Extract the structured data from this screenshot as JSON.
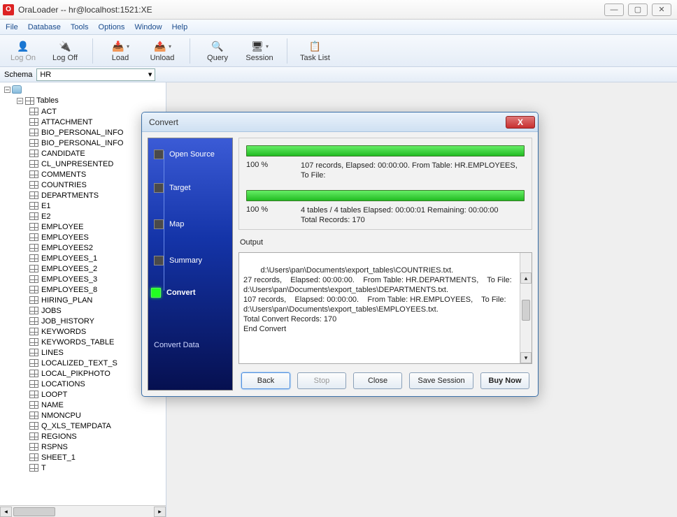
{
  "window": {
    "title": "OraLoader -- hr@localhost:1521:XE"
  },
  "menu": {
    "file": "File",
    "database": "Database",
    "tools": "Tools",
    "options": "Options",
    "window": "Window",
    "help": "Help"
  },
  "toolbar": {
    "logon": "Log On",
    "logoff": "Log Off",
    "load": "Load",
    "unload": "Unload",
    "query": "Query",
    "session": "Session",
    "tasklist": "Task List"
  },
  "schema": {
    "label": "Schema",
    "value": "HR"
  },
  "tree": {
    "tables_label": "Tables",
    "items": [
      "ACT",
      "ATTACHMENT",
      "BIO_PERSONAL_INFO",
      "BIO_PERSONAL_INFO",
      "CANDIDATE",
      "CL_UNPRESENTED",
      "COMMENTS",
      "COUNTRIES",
      "DEPARTMENTS",
      "E1",
      "E2",
      "EMPLOYEE",
      "EMPLOYEES",
      "EMPLOYEES2",
      "EMPLOYEES_1",
      "EMPLOYEES_2",
      "EMPLOYEES_3",
      "EMPLOYEES_8",
      "HIRING_PLAN",
      "JOBS",
      "JOB_HISTORY",
      "KEYWORDS",
      "KEYWORDS_TABLE",
      "LINES",
      "LOCALIZED_TEXT_S",
      "LOCAL_PIKPHOTO",
      "LOCATIONS",
      "LOOPT",
      "NAME",
      "NMONCPU",
      "Q_XLS_TEMPDATA",
      "REGIONS",
      "RSPNS",
      "SHEET_1",
      "T"
    ]
  },
  "dialog": {
    "title": "Convert",
    "steps": {
      "open_source": "Open Source",
      "target": "Target",
      "map": "Map",
      "summary": "Summary",
      "convert": "Convert"
    },
    "footer": "Convert Data",
    "progress1": {
      "pct": "100 %",
      "detail": "107 records,    Elapsed: 00:00:00.    From Table: HR.EMPLOYEES,    To File:"
    },
    "progress2": {
      "pct": "100 %",
      "detail": "4 tables / 4 tables    Elapsed: 00:00:01    Remaining: 00:00:00\nTotal Records: 170"
    },
    "output_label": "Output",
    "output_text": "d:\\Users\\pan\\Documents\\export_tables\\COUNTRIES.txt.\n27 records,    Elapsed: 00:00:00.    From Table: HR.DEPARTMENTS,    To File: d:\\Users\\pan\\Documents\\export_tables\\DEPARTMENTS.txt.\n107 records,    Elapsed: 00:00:00.    From Table: HR.EMPLOYEES,    To File: d:\\Users\\pan\\Documents\\export_tables\\EMPLOYEES.txt.\nTotal Convert Records: 170\nEnd Convert",
    "buttons": {
      "back": "Back",
      "stop": "Stop",
      "close": "Close",
      "save_session": "Save Session",
      "buy_now": "Buy Now"
    }
  }
}
